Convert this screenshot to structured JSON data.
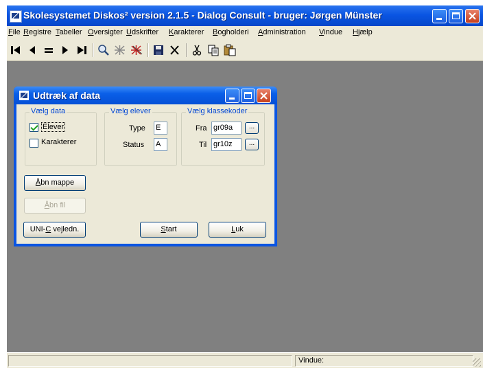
{
  "window": {
    "title": "Skolesystemet Diskos² version 2.1.5 - Dialog Consult - bruger: Jørgen Münster"
  },
  "menubar": {
    "items": [
      {
        "label": "File",
        "key": "F",
        "rest": "ile"
      },
      {
        "label": "Registre",
        "key": "R",
        "rest": "egistre"
      },
      {
        "label": "Tabeller",
        "key": "T",
        "rest": "abeller"
      },
      {
        "label": "Oversigter",
        "key": "O",
        "rest": "versigter"
      },
      {
        "label": "Udskrifter",
        "key": "U",
        "rest": "dskrifter"
      },
      {
        "label": "Karakterer",
        "key": "K",
        "rest": "arakterer"
      },
      {
        "label": "Bogholderi",
        "key": "B",
        "rest": "ogholderi"
      },
      {
        "label": "Administration",
        "key": "A",
        "rest": "dministration"
      },
      {
        "label": "Vindue",
        "key": "V",
        "rest": "indue"
      },
      {
        "label": "Hjælp",
        "key": "H",
        "rest": "jælp"
      }
    ]
  },
  "toolbar": {
    "icons": [
      "first-record-icon",
      "previous-record-icon",
      "equals-icon",
      "next-record-icon",
      "last-record-icon",
      "search-icon",
      "filter-icon",
      "filter-red-icon",
      "save-icon",
      "delete-icon",
      "cut-icon",
      "copy-icon",
      "paste-icon"
    ]
  },
  "dialog": {
    "title": "Udtræk af data",
    "groups": {
      "data": {
        "legend": "Vælg data",
        "elever": {
          "label": "Elever",
          "checked": true
        },
        "karakterer": {
          "label": "Karakterer",
          "checked": false
        }
      },
      "elever": {
        "legend": "Vælg elever",
        "type_label": "Type",
        "type_value": "E",
        "status_label": "Status",
        "status_value": "A"
      },
      "klassekoder": {
        "legend": "Vælg klassekoder",
        "fra_label": "Fra",
        "fra_value": "gr09a",
        "til_label": "Til",
        "til_value": "gr10z",
        "browse_label": "..."
      }
    },
    "buttons": {
      "aabn_mappe": {
        "key": "Å",
        "rest": "bn mappe"
      },
      "aabn_fil": {
        "key": "Å",
        "rest": "bn fil"
      },
      "unic": {
        "pre": "UNI-",
        "key": "C",
        "rest": " vejledn."
      },
      "start": {
        "key": "S",
        "rest": "tart"
      },
      "luk": {
        "key": "L",
        "rest": "uk"
      }
    }
  },
  "statusbar": {
    "vindue_label": "Vindue:"
  },
  "colors": {
    "titlebar": "#0a55e3",
    "mdi_background": "#808080",
    "legend_text": "#0046d5",
    "close_button": "#c6401e"
  }
}
